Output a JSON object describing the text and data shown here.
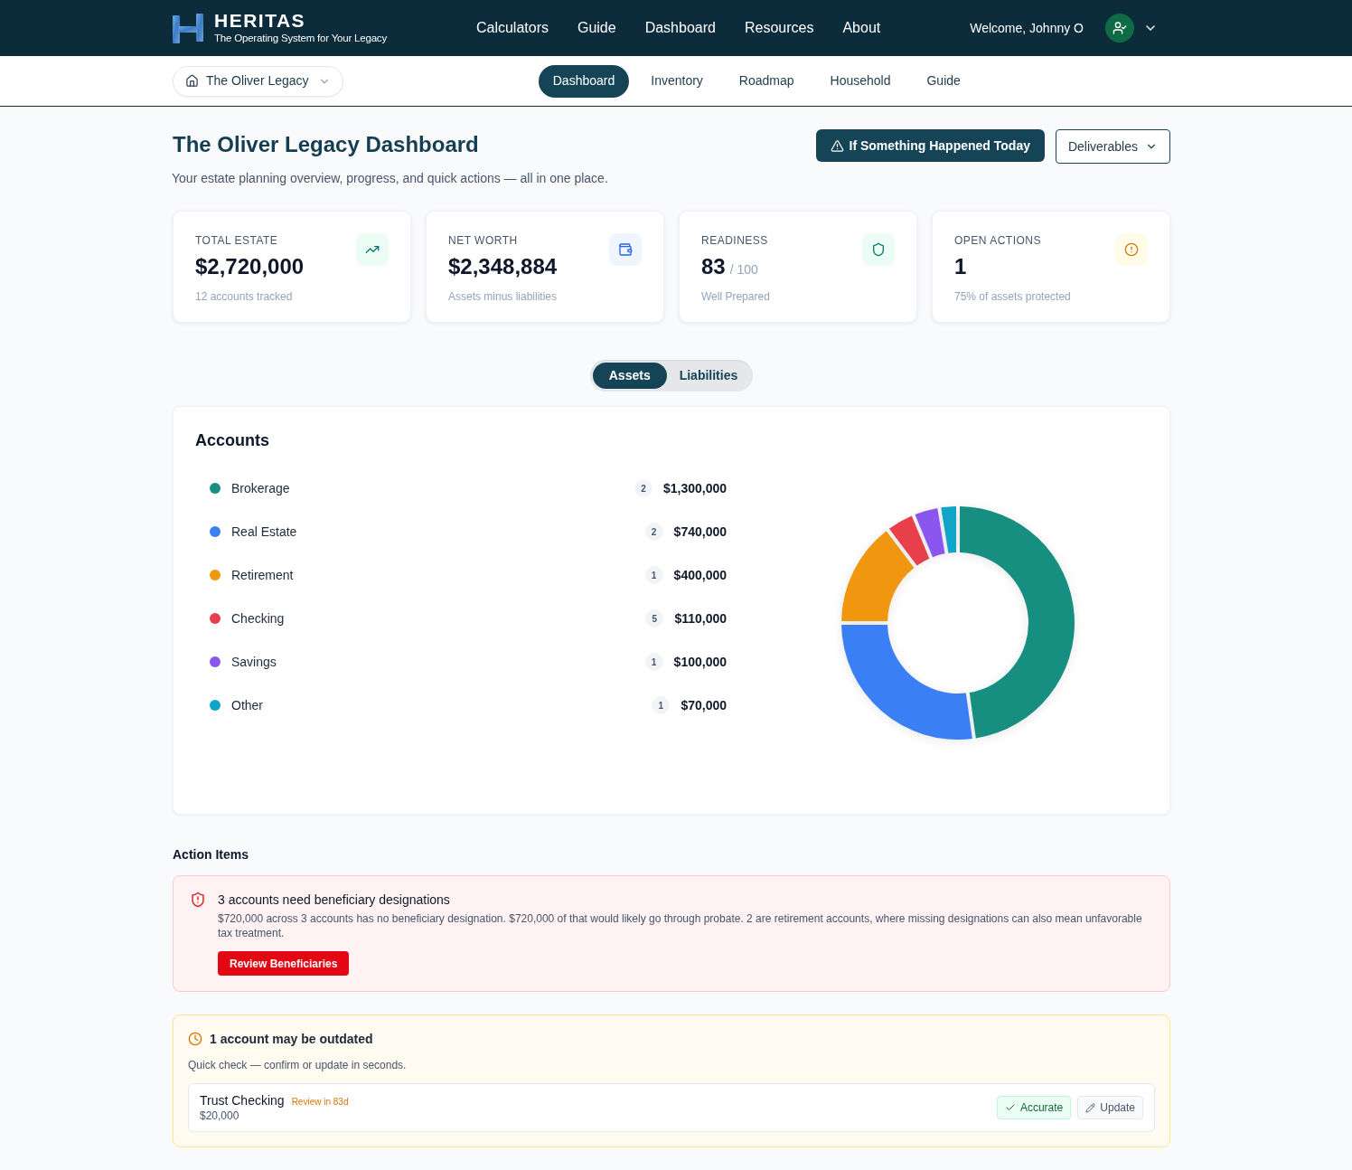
{
  "header": {
    "brand": "HERITAS",
    "tagline": "The Operating System for Your Legacy",
    "nav": [
      "Calculators",
      "Guide",
      "Dashboard",
      "Resources",
      "About"
    ],
    "welcome": "Welcome, Johnny O"
  },
  "subnav": {
    "legacy_selector": "The Oliver Legacy",
    "tabs": [
      {
        "label": "Dashboard",
        "selected": true
      },
      {
        "label": "Inventory",
        "selected": false
      },
      {
        "label": "Roadmap",
        "selected": false
      },
      {
        "label": "Household",
        "selected": false
      },
      {
        "label": "Guide",
        "selected": false
      }
    ]
  },
  "page": {
    "title": "The Oliver Legacy Dashboard",
    "subtitle": "Your estate planning overview, progress, and quick actions — all in one place.",
    "actions": [
      {
        "label": "If Something Happened Today",
        "kind": "primary"
      },
      {
        "label": "Deliverables",
        "kind": "dropdown"
      }
    ]
  },
  "stats": [
    {
      "label": "TOTAL ESTATE",
      "value": "$2,720,000",
      "note": "12 accounts tracked"
    },
    {
      "label": "NET WORTH",
      "value": "$2,348,884",
      "note": "Assets minus liabilities"
    },
    {
      "label": "READINESS",
      "value": "83",
      "scale": "/ 100",
      "note": "Well Prepared"
    },
    {
      "label": "OPEN ACTIONS",
      "value": "1",
      "note": "75% of assets protected"
    }
  ],
  "view_toggle": [
    {
      "label": "Assets",
      "selected": true
    },
    {
      "label": "Liabilities",
      "selected": false
    }
  ],
  "accounts": {
    "title": "Accounts",
    "items": [
      {
        "count": "2",
        "amount": "$1,300,000",
        "color": "#168f80"
      },
      {
        "count": "2",
        "amount": "$740,000",
        "color": "#3b7ff5"
      },
      {
        "count": "1",
        "amount": "$400,000",
        "color": "#f0960f"
      },
      {
        "count": "5",
        "amount": "$110,000",
        "color": "#e8404a"
      },
      {
        "count": "1",
        "amount": "$100,000",
        "color": "#8b55f0"
      },
      {
        "count": "1",
        "amount": "$70,000",
        "color": "#10a5c8"
      }
    ],
    "chart_data": {
      "type": "donut",
      "categories": [
        "Brokerage",
        "Real Estate",
        "Retirement",
        "Checking",
        "Savings",
        "Other"
      ],
      "values": [
        47.79,
        27.21,
        14.71,
        4.04,
        3.68,
        2.57
      ]
    }
  },
  "action_items": {
    "title": "Action Items",
    "beneficiary_alert": {
      "title": "3 accounts need beneficiary designations",
      "description": "$720,000 across 3 accounts has no beneficiary designation. $720,000 of that would likely go through probate. 2 are retirement accounts, where missing designations can also mean unfavorable tax treatment.",
      "button": "Review Beneficiaries"
    },
    "outdated_alert": {
      "title": "1 account may be outdated",
      "description": "Quick check — confirm or update in seconds.",
      "accounts": [
        {
          "name": "Trust Checking",
          "review": "Review in 83d",
          "amount": "$20,000",
          "confirm": "Accurate",
          "update": "Update"
        }
      ]
    }
  }
}
